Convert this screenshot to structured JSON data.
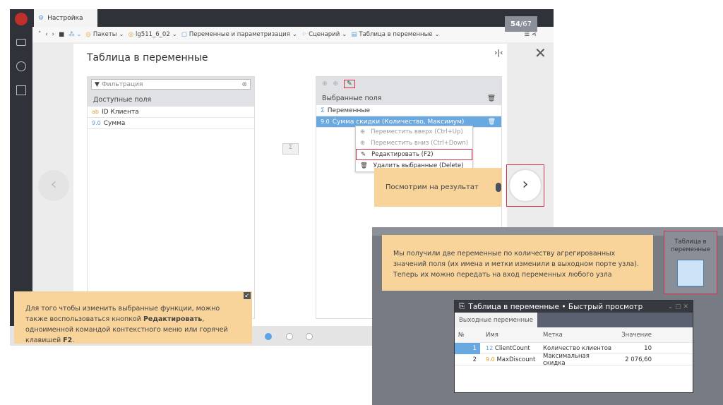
{
  "app": {
    "tab": "Настройка",
    "counter_current": "54",
    "counter_total": "/67",
    "breadcrumbs": [
      "Пакеты",
      "lg511_6_02",
      "Переменные и параметризация",
      "Сценарий",
      "Таблица в переменные"
    ]
  },
  "modal": {
    "title": "Таблица в переменные",
    "left": {
      "filter_placeholder": "Фильтрация",
      "header": "Доступные поля",
      "items": [
        {
          "type": "ab",
          "label": "ID Клиента"
        },
        {
          "type": "9.0",
          "label": "Сумма"
        }
      ]
    },
    "sigma": "Σ",
    "right": {
      "header": "Выбранные поля",
      "group": "Переменные",
      "selected_type": "9.0",
      "selected": "Сумма скидки (Количество, Максимум)"
    },
    "context_menu": [
      "Переместить вверх (Ctrl+Up)",
      "Переместить вниз (Ctrl+Down)",
      "Редактировать (F2)",
      "Удалить выбранные (Delete)"
    ]
  },
  "tooltip": "Посмотрим на результат",
  "note_left": {
    "t1": "Для того чтобы изменить выбранные функции, можно также воспользоваться кнопкой ",
    "b1": "Редактировать",
    "t2": ", одноименной командой контекстного меню или горячей клавишей ",
    "b2": "F2",
    "t3": "."
  },
  "note_right": "Мы получили две переменные по количеству агрегированных значений поля (их имена и метки изменили в выходном порте узла). Теперь их можно передать на вход переменных любого узла",
  "node_label": "Таблица в переменные",
  "dialog": {
    "title": "Таблица в переменные • Быстрый просмотр",
    "tab": "Выходные переменные",
    "columns": [
      "№",
      "Имя",
      "Метка",
      "Значение"
    ],
    "rows": [
      {
        "n": "1",
        "type": "12",
        "name": "ClientCount",
        "label": "Количество клиентов",
        "value": "10"
      },
      {
        "n": "2",
        "type": "9.0",
        "name": "MaxDiscount",
        "label": "Максимальная скидка",
        "value": "2 076,60"
      }
    ]
  }
}
